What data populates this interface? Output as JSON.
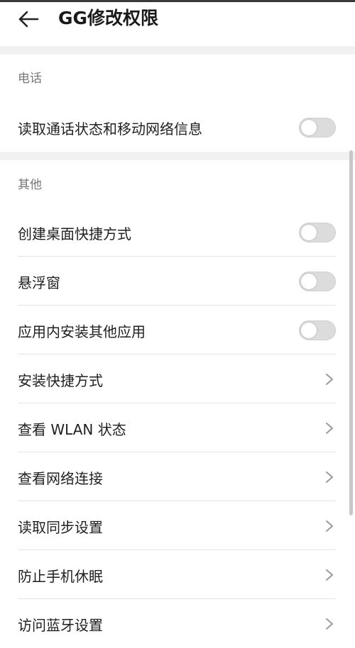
{
  "header": {
    "title": "GG修改权限",
    "back_icon": "arrow-left-icon"
  },
  "sections": [
    {
      "label": "电话",
      "items": [
        {
          "label": "读取通话状态和移动网络信息",
          "control": "toggle",
          "checked": false
        }
      ]
    },
    {
      "label": "其他",
      "items": [
        {
          "label": "创建桌面快捷方式",
          "control": "toggle",
          "checked": false
        },
        {
          "label": "悬浮窗",
          "control": "toggle",
          "checked": false
        },
        {
          "label": "应用内安装其他应用",
          "control": "toggle",
          "checked": false
        },
        {
          "label": "安装快捷方式",
          "control": "chevron"
        },
        {
          "label": "查看 WLAN 状态",
          "control": "chevron"
        },
        {
          "label": "查看网络连接",
          "control": "chevron"
        },
        {
          "label": "读取同步设置",
          "control": "chevron"
        },
        {
          "label": "防止手机休眠",
          "control": "chevron"
        },
        {
          "label": "访问蓝牙设置",
          "control": "chevron"
        }
      ]
    }
  ],
  "colors": {
    "toggle_off": "#dcdcdc",
    "section_gap": "#f1f1f1"
  }
}
